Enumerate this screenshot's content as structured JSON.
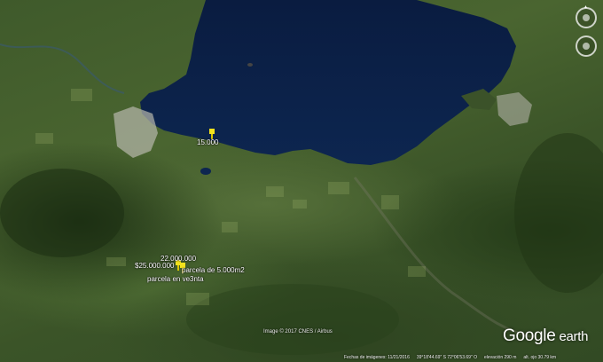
{
  "map": {
    "price_labels": {
      "top": "15.000",
      "p1": "22.000.000",
      "p2": "$25.000.000",
      "parcela_size": "parcela de 5.000m2",
      "parcela_sale": "parcela en ve3nta"
    },
    "credit": "Image © 2017 CNES / Airbus",
    "status": {
      "date": "Fechas de imágenes: 11/21/2016",
      "coords": "39°18'44.69\" S   72°06'53.69\" O",
      "elevation": "elevación   290 m",
      "altitude": "alt. ojo   30.79 km"
    },
    "logo_google": "Google",
    "logo_earth": "earth",
    "icons": {
      "pin": "pushpin-icon",
      "nav": "navigation-control-icon"
    },
    "colors": {
      "lake": "#0b1f45",
      "pin": "#f2e21d",
      "text": "#ffffff"
    }
  }
}
